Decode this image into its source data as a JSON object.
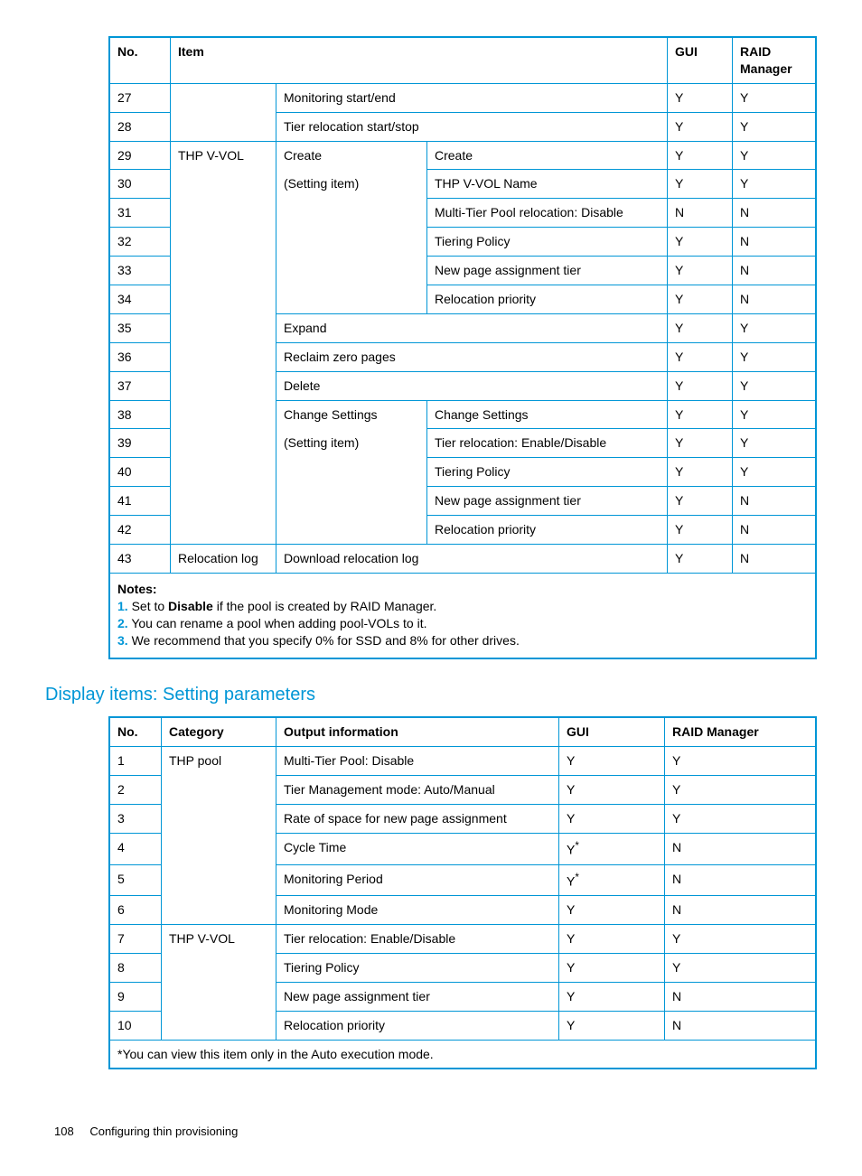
{
  "table1": {
    "headers": {
      "no": "No.",
      "item": "Item",
      "gui": "GUI",
      "raid": "RAID Manager"
    },
    "rows": [
      {
        "no": "27",
        "c1": "",
        "c2": "Monitoring start/end",
        "c3": null,
        "gui": "Y",
        "raid": "Y"
      },
      {
        "no": "28",
        "c1": "",
        "c2": "Tier relocation start/stop",
        "c3": null,
        "gui": "Y",
        "raid": "Y"
      },
      {
        "no": "29",
        "c1": "THP V-VOL",
        "c2": "Create",
        "c3": "Create",
        "gui": "Y",
        "raid": "Y"
      },
      {
        "no": "30",
        "c1": "",
        "c2": "(Setting item)",
        "c3": "THP V-VOL Name",
        "gui": "Y",
        "raid": "Y"
      },
      {
        "no": "31",
        "c1": "",
        "c2": "",
        "c3": "Multi-Tier Pool relocation: Disable",
        "gui": "N",
        "raid": "N"
      },
      {
        "no": "32",
        "c1": "",
        "c2": "",
        "c3": "Tiering Policy",
        "gui": "Y",
        "raid": "N"
      },
      {
        "no": "33",
        "c1": "",
        "c2": "",
        "c3": "New page assignment tier",
        "gui": "Y",
        "raid": "N"
      },
      {
        "no": "34",
        "c1": "",
        "c2": "",
        "c3": "Relocation priority",
        "gui": "Y",
        "raid": "N"
      },
      {
        "no": "35",
        "c1": "",
        "c2": "Expand",
        "c3": null,
        "gui": "Y",
        "raid": "Y"
      },
      {
        "no": "36",
        "c1": "",
        "c2": "Reclaim zero pages",
        "c3": null,
        "gui": "Y",
        "raid": "Y"
      },
      {
        "no": "37",
        "c1": "",
        "c2": "Delete",
        "c3": null,
        "gui": "Y",
        "raid": "Y"
      },
      {
        "no": "38",
        "c1": "",
        "c2": "Change Settings",
        "c3": "Change Settings",
        "gui": "Y",
        "raid": "Y"
      },
      {
        "no": "39",
        "c1": "",
        "c2": "(Setting item)",
        "c3": "Tier relocation: Enable/Disable",
        "gui": "Y",
        "raid": "Y"
      },
      {
        "no": "40",
        "c1": "",
        "c2": "",
        "c3": "Tiering Policy",
        "gui": "Y",
        "raid": "Y"
      },
      {
        "no": "41",
        "c1": "",
        "c2": "",
        "c3": "New page assignment tier",
        "gui": "Y",
        "raid": "N"
      },
      {
        "no": "42",
        "c1": "",
        "c2": "",
        "c3": "Relocation priority",
        "gui": "Y",
        "raid": "N"
      },
      {
        "no": "43",
        "c1": "Relocation log",
        "c2": "Download relocation log",
        "c3": null,
        "gui": "Y",
        "raid": "N"
      }
    ],
    "notes": {
      "title": "Notes:",
      "n1_pre": "Set to ",
      "n1_bold": "Disable",
      "n1_post": " if the pool is created by RAID Manager.",
      "n2": "You can rename a pool when adding pool-VOLs to it.",
      "n3": "We recommend that you specify 0% for SSD and 8% for other drives."
    }
  },
  "section_title": "Display items: Setting parameters",
  "table2": {
    "headers": {
      "no": "No.",
      "cat": "Category",
      "out": "Output information",
      "gui": "GUI",
      "raid": "RAID Manager"
    },
    "rows": [
      {
        "no": "1",
        "cat": "THP pool",
        "out": "Multi-Tier Pool: Disable",
        "gui": "Y",
        "raid": "Y"
      },
      {
        "no": "2",
        "cat": "",
        "out": "Tier Management mode: Auto/Manual",
        "gui": "Y",
        "raid": "Y"
      },
      {
        "no": "3",
        "cat": "",
        "out": "Rate of space for new page assignment",
        "gui": "Y",
        "raid": "Y"
      },
      {
        "no": "4",
        "cat": "",
        "out": "Cycle Time",
        "gui": "Y*",
        "raid": "N"
      },
      {
        "no": "5",
        "cat": "",
        "out": "Monitoring Period",
        "gui": "Y*",
        "raid": "N"
      },
      {
        "no": "6",
        "cat": "",
        "out": "Monitoring Mode",
        "gui": "Y",
        "raid": "N"
      },
      {
        "no": "7",
        "cat": "THP V-VOL",
        "out": "Tier relocation: Enable/Disable",
        "gui": "Y",
        "raid": "Y"
      },
      {
        "no": "8",
        "cat": "",
        "out": "Tiering Policy",
        "gui": "Y",
        "raid": "Y"
      },
      {
        "no": "9",
        "cat": "",
        "out": "New page assignment tier",
        "gui": "Y",
        "raid": "N"
      },
      {
        "no": "10",
        "cat": "",
        "out": "Relocation priority",
        "gui": "Y",
        "raid": "N"
      }
    ],
    "footnote": "*You can view this item only in the Auto execution mode."
  },
  "footer": {
    "page": "108",
    "title": "Configuring thin provisioning"
  }
}
